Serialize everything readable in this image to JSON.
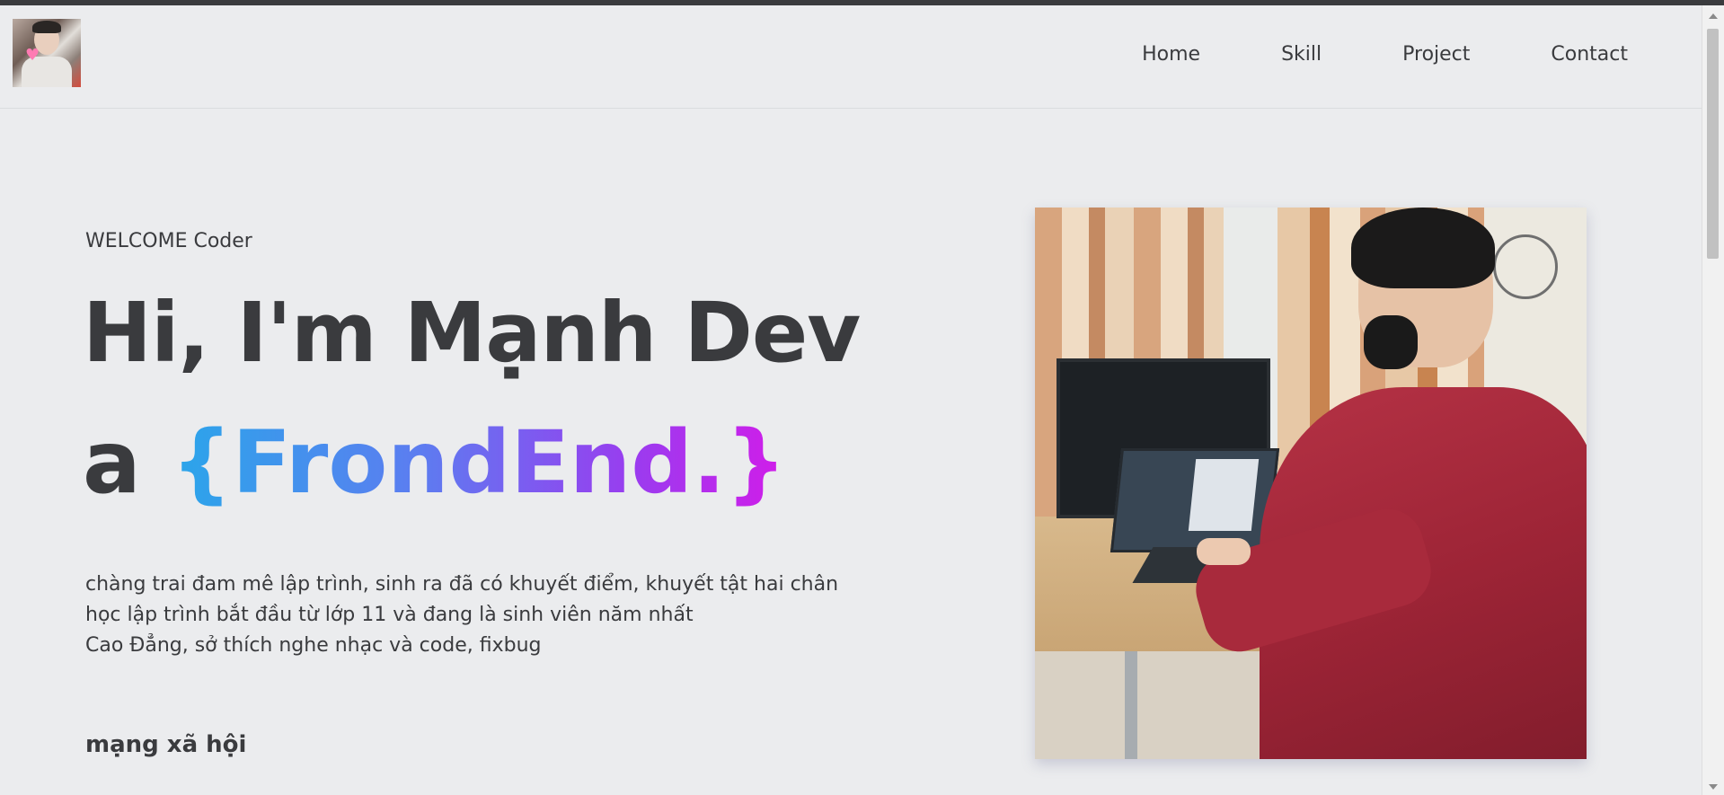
{
  "header": {
    "logo_alt": "avatar",
    "nav": [
      {
        "label": "Home"
      },
      {
        "label": "Skill"
      },
      {
        "label": "Project"
      },
      {
        "label": "Contact"
      }
    ]
  },
  "hero": {
    "welcome": "WELCOME Coder",
    "title_line1": "Hi, I'm Mạnh Dev",
    "title_prefix": "a",
    "title_highlight": "{FrondEnd.}",
    "description": [
      "chàng trai đam mê lập trình, sinh ra đã có khuyết điểm, khuyết tật hai chân",
      "học lập trình bắt đầu từ lớp 11 và đang là sinh viên năm nhất",
      "Cao Đẳng, sở thích nghe nhạc và code, fixbug"
    ],
    "social_heading": "mạng xã hội"
  },
  "colors": {
    "background": "#ebecee",
    "text": "#3a3b3e",
    "gradient_start": "#2aa6ea",
    "gradient_end": "#d21ce9"
  }
}
